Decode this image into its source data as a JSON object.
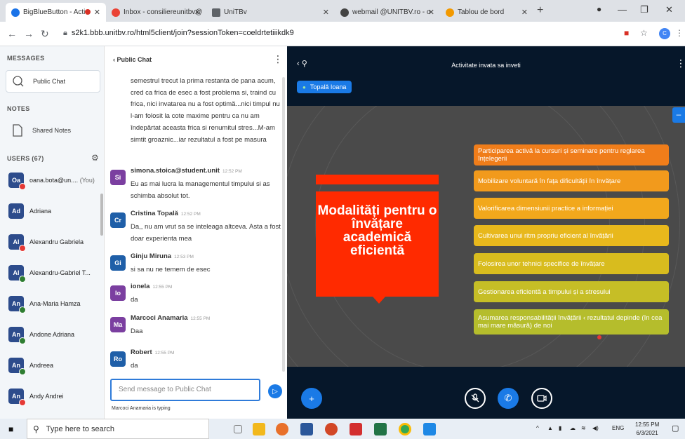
{
  "browser": {
    "tabs": [
      {
        "label": "BigBlueButton - Activ",
        "favicon_color": "#1a73e8"
      },
      {
        "label": "Inbox - consiliereunitbv@",
        "favicon_color": "#ea4335"
      },
      {
        "label": "UniTBv",
        "favicon_color": "#5f6368"
      },
      {
        "label": "webmail @UNITBV.ro - o",
        "favicon_color": "#444444"
      },
      {
        "label": "Tablou de bord",
        "favicon_color": "#f29900"
      }
    ],
    "url": "s2k1.bbb.unitbv.ro/html5client/join?sessionToken=coeldrtetiiikdk9",
    "profile_initial": "C"
  },
  "userpanel": {
    "messages_title": "MESSAGES",
    "public_chat": "Public Chat",
    "notes_title": "NOTES",
    "shared_notes": "Shared Notes",
    "users_title": "USERS (67)",
    "users": [
      {
        "initials": "Oa",
        "name": "oana.bota@un....",
        "suffix": "(You)",
        "color": "#2d4c8c",
        "status": "#e53935"
      },
      {
        "initials": "Ad",
        "name": "Adriana",
        "suffix": "",
        "color": "#2d4c8c",
        "status": ""
      },
      {
        "initials": "Al",
        "name": "Alexandru Gabriela",
        "suffix": "",
        "color": "#2d4c8c",
        "status": "#e53935"
      },
      {
        "initials": "Al",
        "name": "Alexandru-Gabriel T...",
        "suffix": "",
        "color": "#2d4c8c",
        "status": "#2e7d32"
      },
      {
        "initials": "An",
        "name": "Ana-Maria Hamza",
        "suffix": "",
        "color": "#2d4c8c",
        "status": "#2e7d32"
      },
      {
        "initials": "An",
        "name": "Andone Adriana",
        "suffix": "",
        "color": "#2d4c8c",
        "status": "#2e7d32"
      },
      {
        "initials": "An",
        "name": "Andreea",
        "suffix": "",
        "color": "#2d4c8c",
        "status": "#2e7d32"
      },
      {
        "initials": "An",
        "name": "Andy Andrei",
        "suffix": "",
        "color": "#2d4c8c",
        "status": "#e53935"
      }
    ]
  },
  "chat": {
    "title": "Public Chat",
    "continued_text": "semestrul trecut la prima restanta de pana acum, cred ca frica de esec a fost problema si, traind cu frica, nici invatarea nu a fost optimă...nici timpul nu l-am folosit la cote maxime pentru ca nu am îndepărtat aceasta frica si renumitul stres...M-am simtit groaznic...iar rezultatul a fost pe masura",
    "messages": [
      {
        "initials": "Si",
        "color": "#7b3fa0",
        "author": "simona.stoica@student.unit",
        "time": "12:52 PM",
        "text": "Eu as mai lucra la managementul timpului si as schimba absolut tot."
      },
      {
        "initials": "Cr",
        "color": "#1f5fa8",
        "author": "Cristina Topală",
        "time": "12:52 PM",
        "text": "Da,, nu am vrut sa se inteleaga altceva. Asta a fost doar experienta mea"
      },
      {
        "initials": "Gi",
        "color": "#1f5fa8",
        "author": "Ginju Miruna",
        "time": "12:53 PM",
        "text": "si sa nu ne temem de esec"
      },
      {
        "initials": "Io",
        "color": "#7b3fa0",
        "author": "ionela",
        "time": "12:55 PM",
        "text": "da"
      },
      {
        "initials": "Ma",
        "color": "#7b3fa0",
        "author": "Marcoci Anamaria",
        "time": "12:55 PM",
        "text": "Daa"
      },
      {
        "initials": "Ro",
        "color": "#1f5fa8",
        "author": "Robert",
        "time": "12:55 PM",
        "text": "da"
      }
    ],
    "input_placeholder": "Send message to Public Chat",
    "typing": "Marcoci Anamaria is typing"
  },
  "presentation": {
    "title": "Activitate invata sa inveti",
    "speaker": "Topală Ioana",
    "slide_title": "Modalități pentru o învățare academică eficientă",
    "items": [
      {
        "text": "Participarea activă la cursuri și seminare pentru reglarea înțelegerii",
        "color": "#f07d1a"
      },
      {
        "text": "Mobilizare voluntară în fața dificultății în învățare",
        "color": "#f29a1c"
      },
      {
        "text": "Valorificarea dimensiunii practice a informației",
        "color": "#f2a81c"
      },
      {
        "text": "Cultivarea unui ritm propriu eficient al învățării",
        "color": "#e8b81c"
      },
      {
        "text": "Folosirea unor tehnici specifice de învățare",
        "color": "#d8bc1e"
      },
      {
        "text": "Gestionarea eficientă a timpului și a stresului",
        "color": "#c6be26"
      },
      {
        "text": "Asumarea responsabilității învățării ‹ rezultatul depinde (în cea mai mare măsură) de noi",
        "color": "#b5bd2c"
      }
    ]
  },
  "taskbar": {
    "search_placeholder": "Type here to search",
    "lang": "ENG",
    "time": "12:55 PM",
    "date": "6/3/2021"
  }
}
